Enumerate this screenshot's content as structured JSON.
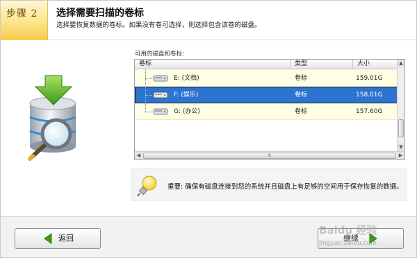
{
  "header": {
    "step_label": "步骤 2",
    "title": "选择需要扫描的卷标",
    "subtitle": "选择要恢复数据的卷标。如果没有卷可选择，则选择包含该卷的磁盘。"
  },
  "volumes": {
    "caption": "可用的磁盘和卷标:",
    "columns": [
      "卷标",
      "类型",
      "大小"
    ],
    "rows": [
      {
        "name": "E: (文档)",
        "type": "卷标",
        "size": "159.01G"
      },
      {
        "name": "F: (娱乐)",
        "type": "卷标",
        "size": "158.01G",
        "selected": true
      },
      {
        "name": "G: (办公)",
        "type": "卷标",
        "size": "157.60G"
      }
    ],
    "hscroll_grip": "Ⅲ"
  },
  "note": {
    "text": "重要: 确保有磁盘连接到您的系统并且磁盘上有足够的空间用于保存恢复的数据。"
  },
  "footer": {
    "back_label": "返回",
    "next_label": "继续"
  },
  "watermark": {
    "brand": "Baidu 经验",
    "url": "jingyan.baidu.com"
  },
  "colors": {
    "step_bg": "#fde58a",
    "row_bg": "#fffde4",
    "selected_row": "#2d73d0",
    "arrow_green": "#3c9a1c"
  }
}
